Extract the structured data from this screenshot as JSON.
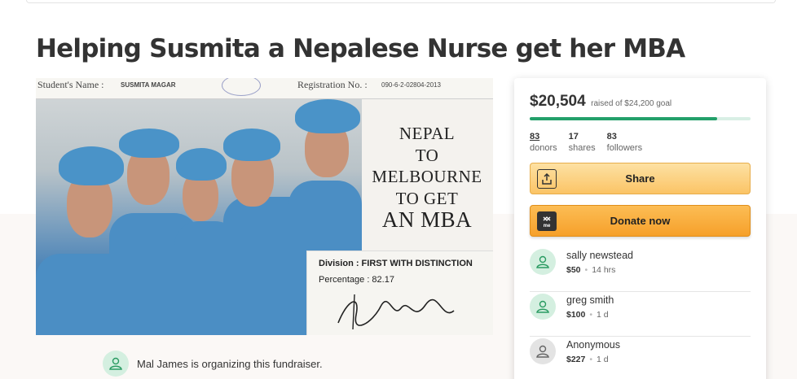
{
  "page": {
    "title": "Helping Susmita a Nepalese Nurse get her MBA"
  },
  "hero": {
    "student_label": "Student's Name :",
    "student_name": "SUSMITA MAGAR",
    "reg_label": "Registration No. :",
    "reg_no": "090-6-2-02804-2013",
    "caption": [
      "NEPAL",
      "TO",
      "MELBOURNE",
      "TO GET",
      "AN MBA"
    ],
    "division": "Division : FIRST WITH DISTINCTION",
    "percentage": "Percentage :  82.17"
  },
  "organizer": {
    "text": "Mal James is organizing this fundraiser."
  },
  "sidebar": {
    "raised_amount": "$20,504",
    "raised_of_goal": "raised of $24,200 goal",
    "progress_fraction": 0.847,
    "stats": [
      {
        "value": "83",
        "label": "donors"
      },
      {
        "value": "17",
        "label": "shares"
      },
      {
        "value": "83",
        "label": "followers"
      }
    ],
    "share_label": "Share",
    "donate_label": "Donate now",
    "donate_icon_text": "me",
    "donations": [
      {
        "name": "sally newstead",
        "amount": "$50",
        "time": "14 hrs"
      },
      {
        "name": "greg smith",
        "amount": "$100",
        "time": "1 d"
      },
      {
        "name": "Anonymous",
        "amount": "$227",
        "time": "1 d"
      }
    ]
  },
  "colors": {
    "accent_green": "#23a06a",
    "share_yellow": "#fbc466",
    "donate_orange": "#f6a02a"
  }
}
